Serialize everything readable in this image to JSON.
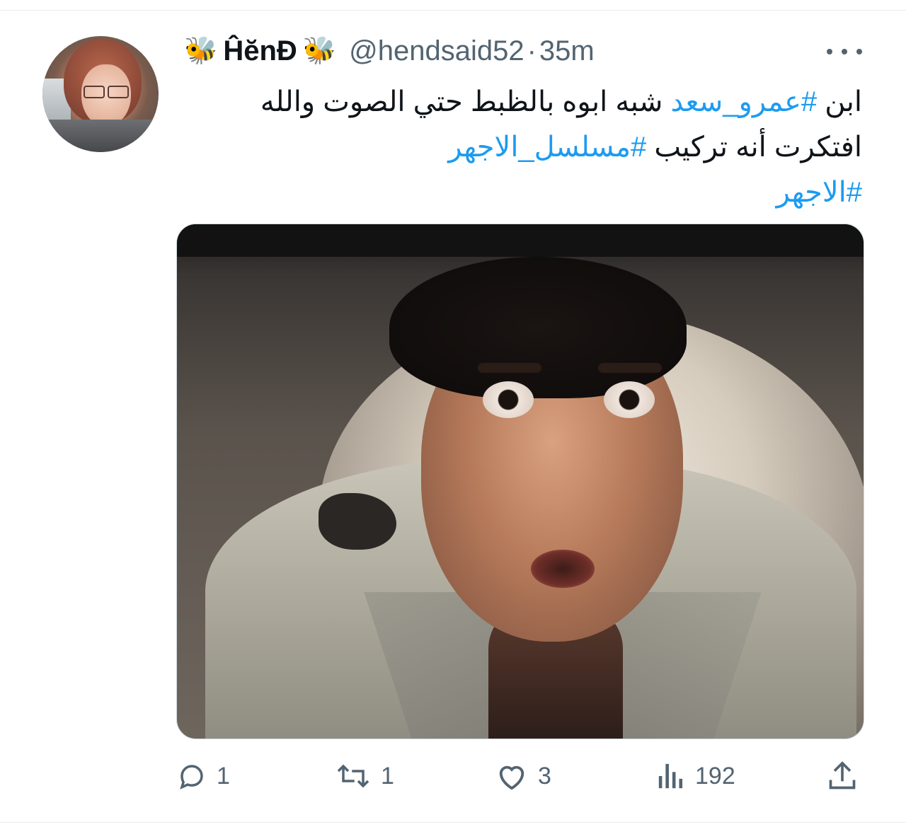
{
  "tweet": {
    "author": {
      "display_name": "ĤĕnĐ",
      "emoji_left": "🐝",
      "emoji_right": "🐝",
      "handle": "@hendsaid52",
      "separator": "·",
      "timestamp": "35m"
    },
    "text": {
      "part1": "ابن ",
      "hashtag1": "#عمرو_سعد",
      "part2": " شبه ابوه بالظبط حتي الصوت والله افتكرت أنه تركيب ",
      "hashtag2": "#مسلسل_الاجهر",
      "part3": " ",
      "hashtag3": "#الاجهر"
    },
    "actions": {
      "reply_count": "1",
      "retweet_count": "1",
      "like_count": "3",
      "views_count": "192"
    }
  },
  "icons": {
    "more": "more-icon",
    "reply": "reply-icon",
    "retweet": "retweet-icon",
    "like": "heart-icon",
    "views": "views-icon",
    "share": "share-icon"
  },
  "colors": {
    "text": "#0f1419",
    "secondary": "#536471",
    "hashtag": "#1d9bf0",
    "divider": "#e6ecf0"
  }
}
